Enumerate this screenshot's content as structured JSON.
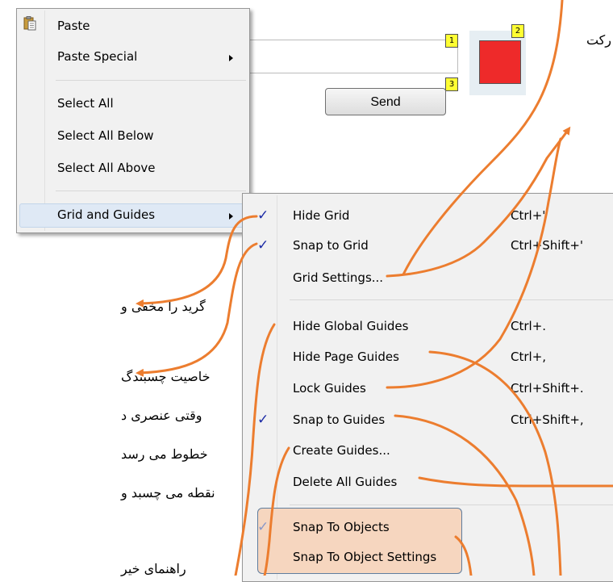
{
  "colors": {
    "accent_orange": "#ec7d2f",
    "check_blue": "#1c2ba6",
    "badge_yellow": "#ffff33",
    "red_box": "#ee2a2a"
  },
  "send_label": "Send",
  "badges": [
    "1",
    "2",
    "3"
  ],
  "persian_text": {
    "top_right": "رکت",
    "hide_grid_note": "گرید را مخفی و",
    "snap_note_1": "خاصیت چسبندگ",
    "snap_note_2": "وقتی عنصری د",
    "snap_note_3": "خطوط می رسد",
    "snap_note_4": "نقطه می چسبد و",
    "snap_note_5": "راهنمای خیر"
  },
  "context_menu": {
    "paste": "Paste",
    "paste_special": "Paste Special",
    "select_all": "Select All",
    "select_all_below": "Select All Below",
    "select_all_above": "Select All Above",
    "grid_and_guides": "Grid and Guides"
  },
  "submenu": {
    "hide_grid": {
      "label": "Hide Grid",
      "shortcut": "Ctrl+'",
      "checked": true
    },
    "snap_to_grid": {
      "label": "Snap to Grid",
      "shortcut": "Ctrl+Shift+'",
      "checked": true
    },
    "grid_settings": {
      "label": "Grid Settings..."
    },
    "hide_global_guides": {
      "label": "Hide Global Guides",
      "shortcut": "Ctrl+."
    },
    "hide_page_guides": {
      "label": "Hide Page Guides",
      "shortcut": "Ctrl+,"
    },
    "lock_guides": {
      "label": "Lock Guides",
      "shortcut": "Ctrl+Shift+."
    },
    "snap_to_guides": {
      "label": "Snap to Guides",
      "shortcut": "Ctrl+Shift+,",
      "checked": true
    },
    "create_guides": {
      "label": "Create Guides..."
    },
    "delete_all_guides": {
      "label": "Delete All Guides"
    },
    "snap_to_objects": {
      "label": "Snap To Objects",
      "checked": true
    },
    "snap_to_object_settings": {
      "label": "Snap To Object Settings"
    }
  }
}
